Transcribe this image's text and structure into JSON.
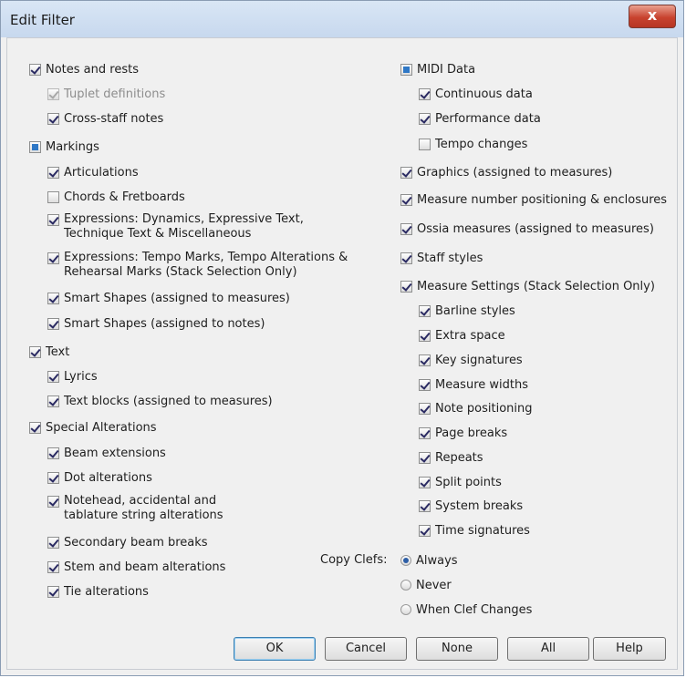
{
  "dialog": {
    "title": "Edit Filter",
    "close_glyph": "x"
  },
  "left": [
    {
      "label": "Notes and rests",
      "state": "checked"
    },
    {
      "label": "Tuplet definitions",
      "state": "checked-disabled"
    },
    {
      "label": "Cross-staff notes",
      "state": "checked"
    },
    {
      "label": "Markings",
      "state": "indeterminate"
    },
    {
      "label": "Articulations",
      "state": "checked"
    },
    {
      "label": "Chords & Fretboards",
      "state": "unchecked"
    },
    {
      "label": "Expressions: Dynamics, Expressive Text,",
      "label2": "Technique Text & Miscellaneous",
      "state": "checked"
    },
    {
      "label": "Expressions: Tempo Marks, Tempo Alterations &",
      "label2": "Rehearsal Marks (Stack Selection Only)",
      "state": "checked"
    },
    {
      "label": "Smart Shapes (assigned to measures)",
      "state": "checked"
    },
    {
      "label": "Smart Shapes (assigned to notes)",
      "state": "checked"
    },
    {
      "label": "Text",
      "state": "checked"
    },
    {
      "label": "Lyrics",
      "state": "checked"
    },
    {
      "label": "Text blocks (assigned to measures)",
      "state": "checked"
    },
    {
      "label": "Special Alterations",
      "state": "checked"
    },
    {
      "label": "Beam extensions",
      "state": "checked"
    },
    {
      "label": "Dot alterations",
      "state": "checked"
    },
    {
      "label": "Notehead, accidental and",
      "label2": "tablature string alterations",
      "state": "checked"
    },
    {
      "label": "Secondary beam breaks",
      "state": "checked"
    },
    {
      "label": "Stem and beam alterations",
      "state": "checked"
    },
    {
      "label": "Tie alterations",
      "state": "checked"
    }
  ],
  "right": [
    {
      "label": "MIDI Data",
      "state": "indeterminate"
    },
    {
      "label": "Continuous data",
      "state": "checked"
    },
    {
      "label": "Performance data",
      "state": "checked"
    },
    {
      "label": "Tempo changes",
      "state": "unchecked"
    },
    {
      "label": "Graphics (assigned to measures)",
      "state": "checked"
    },
    {
      "label": "Measure number positioning & enclosures",
      "state": "checked"
    },
    {
      "label": "Ossia measures (assigned to measures)",
      "state": "checked"
    },
    {
      "label": "Staff styles",
      "state": "checked"
    },
    {
      "label": "Measure Settings (Stack Selection Only)",
      "state": "checked"
    },
    {
      "label": "Barline styles",
      "state": "checked"
    },
    {
      "label": "Extra space",
      "state": "checked"
    },
    {
      "label": "Key signatures",
      "state": "checked"
    },
    {
      "label": "Measure widths",
      "state": "checked"
    },
    {
      "label": "Note positioning",
      "state": "checked"
    },
    {
      "label": "Page breaks",
      "state": "checked"
    },
    {
      "label": "Repeats",
      "state": "checked"
    },
    {
      "label": "Split points",
      "state": "checked"
    },
    {
      "label": "System breaks",
      "state": "checked"
    },
    {
      "label": "Time signatures",
      "state": "checked"
    }
  ],
  "copy_clefs": {
    "label": "Copy Clefs:",
    "options": [
      {
        "label": "Always",
        "selected": true
      },
      {
        "label": "Never",
        "selected": false
      },
      {
        "label": "When Clef Changes",
        "selected": false
      }
    ]
  },
  "buttons": {
    "ok": "OK",
    "cancel": "Cancel",
    "none": "None",
    "all": "All",
    "help": "Help"
  }
}
